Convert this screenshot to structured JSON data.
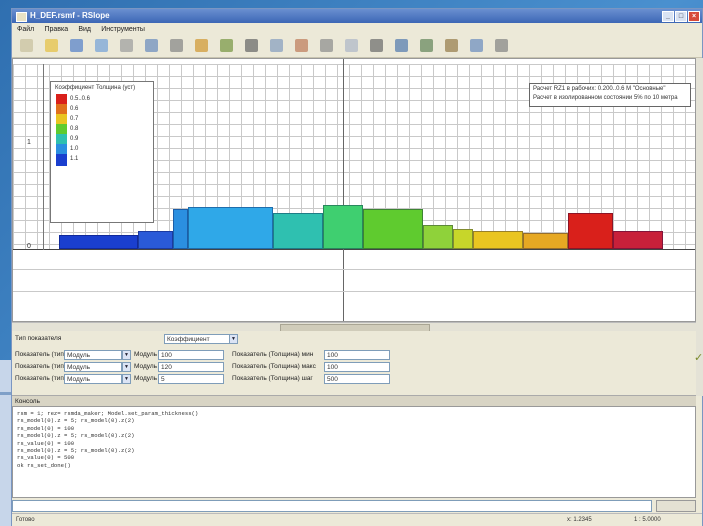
{
  "window": {
    "title": "H_DEF.rsmf - RSlope",
    "controls": [
      "_",
      "□",
      "×"
    ]
  },
  "menu": [
    "Файл",
    "Правка",
    "Вид",
    "Инструменты"
  ],
  "toolbar": {
    "icons": [
      "new-icon",
      "open-icon",
      "save-icon",
      "undo-icon",
      "redo-icon",
      "pointer-icon",
      "line-icon",
      "edit-icon",
      "node-icon",
      "select-icon",
      "table-icon",
      "move-icon",
      "label-icon",
      "zoom-icon",
      "text-icon",
      "chart-icon",
      "zoom-in-icon",
      "zoom-out-icon",
      "fit-icon",
      "settings-icon"
    ]
  },
  "canvas": {
    "y_ticks": [
      "1",
      "0"
    ],
    "legend": {
      "title": "Коэффициент Толщина (уст)",
      "items": [
        {
          "color": "#d9201b",
          "label": "0.5..0.6"
        },
        {
          "color": "#e0701c",
          "label": "0.6"
        },
        {
          "color": "#e9c521",
          "label": "0.7"
        },
        {
          "color": "#5fcb2f",
          "label": "0.8"
        },
        {
          "color": "#2fc0b0",
          "label": "0.9"
        },
        {
          "color": "#2b8fe0",
          "label": "1.0"
        },
        {
          "color": "#1a3fcf",
          "label": "1.1"
        }
      ]
    },
    "note_lines": [
      "Расчет RZ1 в рабочих: 0.200..0.6 М \"Основные\"",
      "Расчет в изолированном состоянии 5% по 10 метра"
    ]
  },
  "props": {
    "title": "Тип показателя",
    "title_value": "Коэффициент",
    "rows": [
      {
        "label": "Показатель (тип)",
        "select": "Модуль",
        "field_label": "Модуль",
        "field_value": "100",
        "right_label": "Показатель (Толщина) мин",
        "right_value": "100"
      },
      {
        "label": "Показатель (тип)",
        "select": "Модуль",
        "field_label": "Модуль",
        "field_value": "120",
        "right_label": "Показатель (Толщина) макс",
        "right_value": "100"
      },
      {
        "label": "Показатель (тип)",
        "select": "Модуль",
        "field_label": "Модуль",
        "field_value": "5",
        "right_label": "Показатель (Толщина) шаг",
        "right_value": "500"
      }
    ]
  },
  "console": {
    "title": "Консоль",
    "lines": [
      "rsm = 1; rez= rsmda_maker; Model.set_param_thickness()",
      "rs_model(0).z = 5; rs_model(0).z(2)",
      "rs_model(0) = 100",
      "rs_model(0).z = 5; rs_model(0).z(2)",
      "rs_value(0) = 100",
      "rs_model(0).z = 5; rs_model(0).z(2)",
      "rs_value(0) = 500",
      "ok rs_set_done()"
    ]
  },
  "status": {
    "left": "Готово",
    "coords": "x: 1.2345",
    "scale": "1 : 5.0000"
  }
}
